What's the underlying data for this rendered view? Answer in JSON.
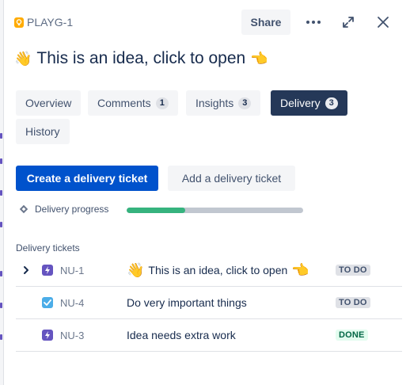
{
  "header": {
    "issue_key": "PLAYG-1",
    "share_label": "Share",
    "title": "This is an idea, click to open",
    "title_emoji_start": "👋",
    "title_emoji_end": "👈"
  },
  "tabs": [
    {
      "label": "Overview",
      "count": null
    },
    {
      "label": "Comments",
      "count": "1"
    },
    {
      "label": "Insights",
      "count": "3"
    },
    {
      "label": "Delivery",
      "count": "3",
      "active": true
    },
    {
      "label": "History",
      "count": null
    }
  ],
  "actions": {
    "create_label": "Create a delivery ticket",
    "add_label": "Add a delivery ticket"
  },
  "progress": {
    "label": "Delivery progress",
    "done_fraction": 0.33
  },
  "tickets": {
    "section_label": "Delivery tickets",
    "rows": [
      {
        "key": "NU-1",
        "type": "epic",
        "summary": "This is an idea, click to open",
        "emoji_start": "👋",
        "emoji_end": "👈",
        "status": "TO DO"
      },
      {
        "key": "NU-4",
        "type": "task",
        "summary": "Do very important things",
        "status": "TO DO"
      },
      {
        "key": "NU-3",
        "type": "epic",
        "summary": "Idea needs extra work",
        "status": "DONE"
      }
    ]
  },
  "colors": {
    "primary": "#0052cc",
    "active_tab": "#253858",
    "progress_done": "#36b37e",
    "epic": "#6554c0",
    "task": "#4bade8",
    "idea": "#ffab00"
  }
}
